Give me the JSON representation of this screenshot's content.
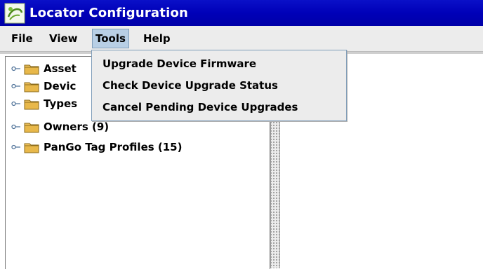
{
  "window": {
    "title": "Locator Configuration",
    "icon": "locator-app-icon"
  },
  "menubar": {
    "items": [
      {
        "label": "File",
        "active": false
      },
      {
        "label": "View",
        "active": false
      },
      {
        "label": "Tools",
        "active": true
      },
      {
        "label": "Help",
        "active": false
      }
    ]
  },
  "tools_menu": {
    "items": [
      {
        "label": "Upgrade Device Firmware"
      },
      {
        "label": "Check Device Upgrade Status"
      },
      {
        "label": "Cancel Pending Device Upgrades"
      }
    ]
  },
  "tree": {
    "nodes": [
      {
        "label": "Asset",
        "icon": "folder-icon",
        "expander": "collapsed-key-icon"
      },
      {
        "label": "Devic",
        "icon": "folder-icon",
        "expander": "collapsed-key-icon"
      },
      {
        "label": "Types",
        "icon": "folder-icon",
        "expander": "collapsed-key-icon"
      },
      {
        "label": "Owners (9)",
        "icon": "folder-icon",
        "expander": "collapsed-key-icon"
      },
      {
        "label": "PanGo Tag Profiles (15)",
        "icon": "folder-icon",
        "expander": "collapsed-key-icon"
      }
    ]
  },
  "colors": {
    "titlebar": "#0000b8",
    "menu_highlight": "#b8cfe5",
    "menu_border": "#7f9db9",
    "folder": "#e8b84a"
  }
}
